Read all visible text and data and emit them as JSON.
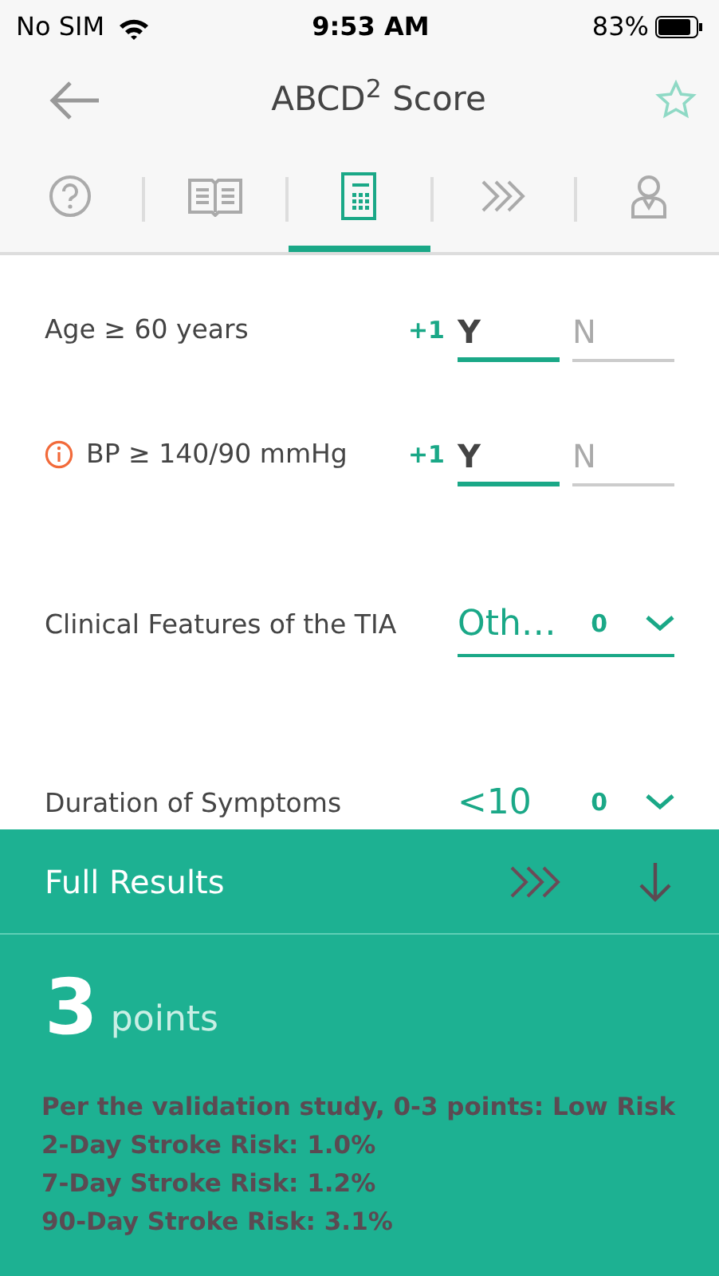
{
  "status_bar": {
    "carrier": "No SIM",
    "time": "9:53 AM",
    "battery": "83%"
  },
  "nav": {
    "title": "ABCD$^{2}$ Score",
    "favorite": false
  },
  "tabs": [
    {
      "selected": false
    },
    {
      "selected": false
    },
    {
      "selected": true
    },
    {
      "selected": false
    },
    {
      "selected": false
    }
  ],
  "fields": [
    {
      "kind": "toggle",
      "label": "Age ≥ 60 years",
      "info": false,
      "points": "+1",
      "options": [
        {
          "label": "Y",
          "selected": true
        },
        {
          "label": "N",
          "selected": false
        }
      ]
    },
    {
      "kind": "toggle",
      "label": "BP ≥ 140/90 mmHg",
      "info": true,
      "points": "+1",
      "options": [
        {
          "label": "Y",
          "selected": true
        },
        {
          "label": "N",
          "selected": false
        }
      ]
    },
    {
      "kind": "select",
      "label": "Clinical Features of the TIA",
      "value": "Oth…",
      "points": "0"
    },
    {
      "kind": "select",
      "label": "Duration of Symptoms",
      "value": "<10",
      "points": "0"
    }
  ],
  "results": {
    "header": "Full Results",
    "score": "3",
    "unit": "points",
    "lines": [
      "Per the validation study, 0-3 points: Low Risk",
      "2-Day Stroke Risk: 1.0%",
      "7-Day Stroke Risk: 1.2%",
      "90-Day Stroke Risk: 3.1%"
    ]
  }
}
